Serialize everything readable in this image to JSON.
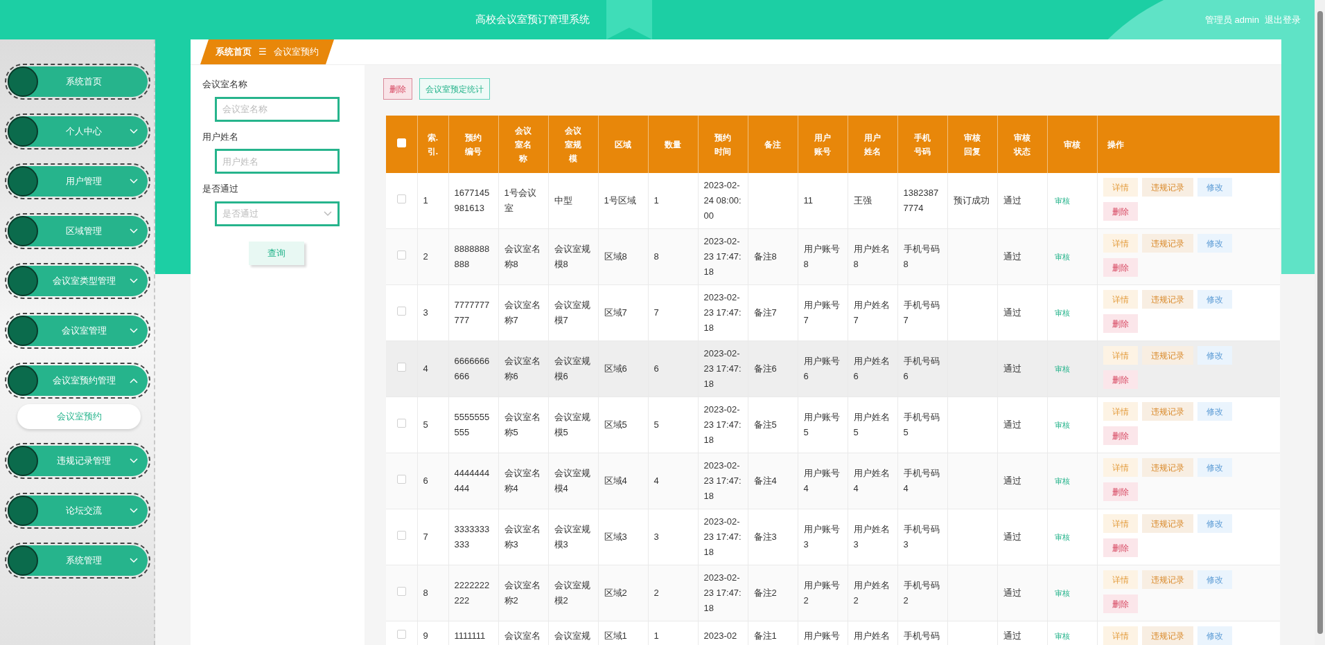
{
  "header": {
    "title": "高校会议室预订管理系统",
    "user": "管理员 admin",
    "logout": "退出登录"
  },
  "sidebar": {
    "items": [
      {
        "label": "系统首页",
        "kind": "link"
      },
      {
        "label": "个人中心",
        "kind": "group",
        "expanded": false
      },
      {
        "label": "用户管理",
        "kind": "group",
        "expanded": false
      },
      {
        "label": "区域管理",
        "kind": "group",
        "expanded": false
      },
      {
        "label": "会议室类型管理",
        "kind": "group",
        "expanded": false
      },
      {
        "label": "会议室管理",
        "kind": "group",
        "expanded": false
      },
      {
        "label": "会议室预约管理",
        "kind": "group",
        "expanded": true,
        "children": [
          {
            "label": "会议室预约",
            "selected": true
          }
        ]
      },
      {
        "label": "违规记录管理",
        "kind": "group",
        "expanded": false
      },
      {
        "label": "论坛交流",
        "kind": "group",
        "expanded": false
      },
      {
        "label": "系统管理",
        "kind": "group",
        "expanded": false
      }
    ]
  },
  "breadcrumb": {
    "home": "系统首页",
    "separator": "☰",
    "current": "会议室预约"
  },
  "filters": [
    {
      "kind": "input",
      "label": "会议室名称",
      "placeholder": "会议室名称"
    },
    {
      "kind": "input",
      "label": "用户姓名",
      "placeholder": "用户姓名"
    },
    {
      "kind": "select",
      "label": "是否通过",
      "placeholder": "是否通过"
    }
  ],
  "query_button": "查询",
  "toolbar": [
    {
      "kind": "delete",
      "label": "删除"
    },
    {
      "kind": "stats",
      "label": "会议室预定统计"
    }
  ],
  "table": {
    "header_checkbox": {
      "checked": false
    },
    "columns": [
      "索.引.",
      "预约编号",
      "会议室名称",
      "会议室规模",
      "区域",
      "数量",
      "预约时间",
      "备注",
      "用户账号",
      "用户姓名",
      "手机号码",
      "审核回复",
      "审核状态",
      "审核",
      "操作"
    ],
    "rows": [
      {
        "checked": false,
        "hovered": false,
        "cells": [
          "1",
          "1677145981613",
          "1号会议室",
          "中型",
          "1号区域",
          "1",
          "2023-02-24 08:00:00",
          null,
          "11",
          "王强",
          "13823877774",
          "预订成功",
          "通过"
        ],
        "review": "审核",
        "actions": [
          {
            "kind": "detail",
            "label": "详情"
          },
          {
            "kind": "violation",
            "label": "违规记录"
          },
          {
            "kind": "edit",
            "label": "修改"
          },
          {
            "kind": "delete",
            "label": "删除"
          }
        ]
      },
      {
        "checked": false,
        "hovered": false,
        "cells": [
          "2",
          "8888888888",
          "会议室名称8",
          "会议室规模8",
          "区域8",
          "8",
          "2023-02-23 17:47:18",
          "备注8",
          "用户账号8",
          "用户姓名8",
          "手机号码8",
          null,
          "通过"
        ],
        "review": "审核",
        "actions": [
          {
            "kind": "detail",
            "label": "详情"
          },
          {
            "kind": "violation",
            "label": "违规记录"
          },
          {
            "kind": "edit",
            "label": "修改"
          },
          {
            "kind": "delete",
            "label": "删除"
          }
        ]
      },
      {
        "checked": false,
        "hovered": false,
        "cells": [
          "3",
          "7777777777",
          "会议室名称7",
          "会议室规模7",
          "区域7",
          "7",
          "2023-02-23 17:47:18",
          "备注7",
          "用户账号7",
          "用户姓名7",
          "手机号码7",
          null,
          "通过"
        ],
        "review": "审核",
        "actions": [
          {
            "kind": "detail",
            "label": "详情"
          },
          {
            "kind": "violation",
            "label": "违规记录"
          },
          {
            "kind": "edit",
            "label": "修改"
          },
          {
            "kind": "delete",
            "label": "删除"
          }
        ]
      },
      {
        "checked": false,
        "hovered": true,
        "cells": [
          "4",
          "6666666666",
          "会议室名称6",
          "会议室规模6",
          "区域6",
          "6",
          "2023-02-23 17:47:18",
          "备注6",
          "用户账号6",
          "用户姓名6",
          "手机号码6",
          null,
          "通过"
        ],
        "review": "审核",
        "actions": [
          {
            "kind": "detail",
            "label": "详情"
          },
          {
            "kind": "violation",
            "label": "违规记录"
          },
          {
            "kind": "edit",
            "label": "修改"
          },
          {
            "kind": "delete",
            "label": "删除"
          }
        ]
      },
      {
        "checked": false,
        "hovered": false,
        "cells": [
          "5",
          "5555555555",
          "会议室名称5",
          "会议室规模5",
          "区域5",
          "5",
          "2023-02-23 17:47:18",
          "备注5",
          "用户账号5",
          "用户姓名5",
          "手机号码5",
          null,
          "通过"
        ],
        "review": "审核",
        "actions": [
          {
            "kind": "detail",
            "label": "详情"
          },
          {
            "kind": "violation",
            "label": "违规记录"
          },
          {
            "kind": "edit",
            "label": "修改"
          },
          {
            "kind": "delete",
            "label": "删除"
          }
        ]
      },
      {
        "checked": false,
        "hovered": false,
        "cells": [
          "6",
          "4444444444",
          "会议室名称4",
          "会议室规模4",
          "区域4",
          "4",
          "2023-02-23 17:47:18",
          "备注4",
          "用户账号4",
          "用户姓名4",
          "手机号码4",
          null,
          "通过"
        ],
        "review": "审核",
        "actions": [
          {
            "kind": "detail",
            "label": "详情"
          },
          {
            "kind": "violation",
            "label": "违规记录"
          },
          {
            "kind": "edit",
            "label": "修改"
          },
          {
            "kind": "delete",
            "label": "删除"
          }
        ]
      },
      {
        "checked": false,
        "hovered": false,
        "cells": [
          "7",
          "3333333333",
          "会议室名称3",
          "会议室规模3",
          "区域3",
          "3",
          "2023-02-23 17:47:18",
          "备注3",
          "用户账号3",
          "用户姓名3",
          "手机号码3",
          null,
          "通过"
        ],
        "review": "审核",
        "actions": [
          {
            "kind": "detail",
            "label": "详情"
          },
          {
            "kind": "violation",
            "label": "违规记录"
          },
          {
            "kind": "edit",
            "label": "修改"
          },
          {
            "kind": "delete",
            "label": "删除"
          }
        ]
      },
      {
        "checked": false,
        "hovered": false,
        "cells": [
          "8",
          "2222222222",
          "会议室名称2",
          "会议室规模2",
          "区域2",
          "2",
          "2023-02-23 17:47:18",
          "备注2",
          "用户账号2",
          "用户姓名2",
          "手机号码2",
          null,
          "通过"
        ],
        "review": "审核",
        "actions": [
          {
            "kind": "detail",
            "label": "详情"
          },
          {
            "kind": "violation",
            "label": "违规记录"
          },
          {
            "kind": "edit",
            "label": "修改"
          },
          {
            "kind": "delete",
            "label": "删除"
          }
        ]
      },
      {
        "checked": false,
        "hovered": false,
        "cells": [
          "9",
          "1111111",
          "会议室名",
          "会议室规",
          "区域1",
          "1",
          "2023-02",
          "备注1",
          "用户账号",
          "用户姓名",
          "手机号码",
          null,
          "通过"
        ],
        "review": "审核",
        "actions": [
          {
            "kind": "detail",
            "label": "详情"
          },
          {
            "kind": "violation",
            "label": "违规记录"
          },
          {
            "kind": "edit",
            "label": "修改"
          }
        ]
      }
    ]
  }
}
